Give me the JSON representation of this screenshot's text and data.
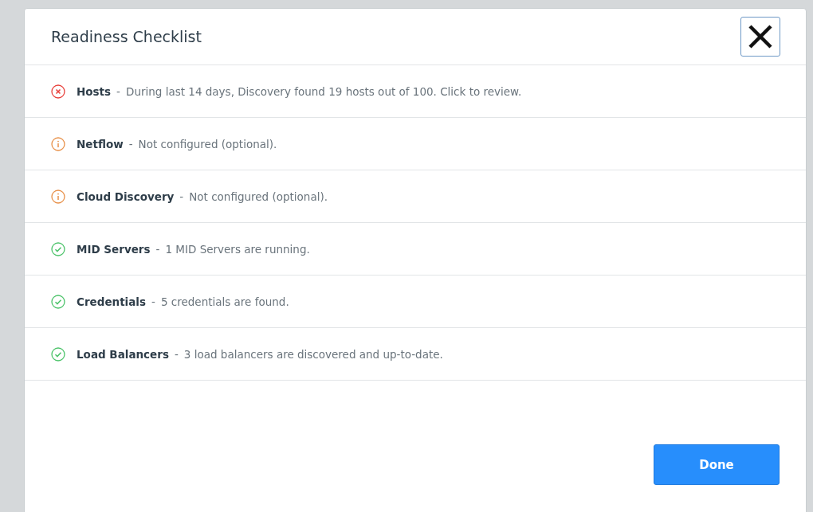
{
  "dialog": {
    "title": "Readiness Checklist",
    "items": [
      {
        "kind": "error",
        "name": "Hosts",
        "separator": "-",
        "description": "During last 14 days, Discovery found 19 hosts out of 100. Click to review."
      },
      {
        "kind": "warning",
        "name": "Netflow",
        "separator": "-",
        "description": "Not configured (optional)."
      },
      {
        "kind": "warning",
        "name": "Cloud Discovery",
        "separator": "-",
        "description": "Not configured (optional)."
      },
      {
        "kind": "ok",
        "name": "MID Servers",
        "separator": "-",
        "description": "1 MID Servers are running."
      },
      {
        "kind": "ok",
        "name": "Credentials",
        "separator": "-",
        "description": "5 credentials are found."
      },
      {
        "kind": "ok",
        "name": "Load Balancers",
        "separator": "-",
        "description": "3 load balancers are discovered and up-to-date."
      }
    ],
    "button": "Done"
  }
}
